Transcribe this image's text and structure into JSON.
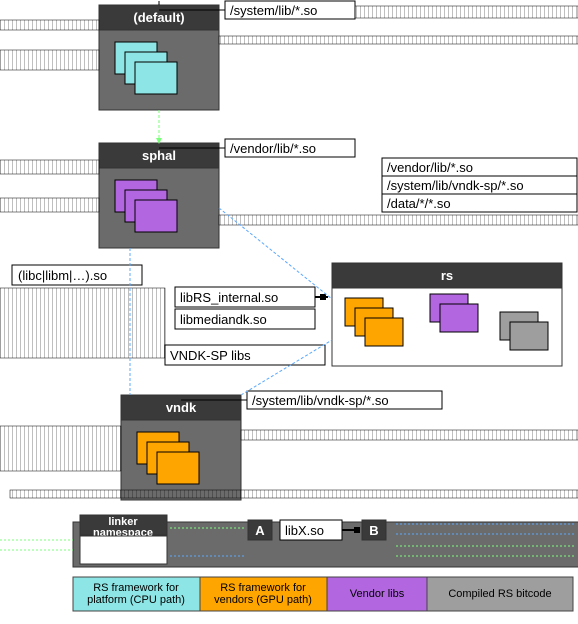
{
  "namespaces": {
    "default": {
      "title": "(default)",
      "search_path": "/system/lib/*.so"
    },
    "sphal": {
      "title": "sphal",
      "search_path": "/vendor/lib/*.so",
      "permitted": [
        "/vendor/lib/*.so",
        "/system/lib/vndk-sp/*.so",
        "/data/*/*.so"
      ]
    },
    "rs": {
      "title": "rs"
    },
    "vndk": {
      "title": "vndk",
      "search_path": "/system/lib/vndk-sp/*.so"
    }
  },
  "details": {
    "libc_group": "(libc|libm|…).so",
    "librs": "libRS_internal.so",
    "libmediandk": "libmediandk.so",
    "vndk_sp_libs": "VNDK-SP libs"
  },
  "legend": {
    "linker_ns": "linker\nnamespace",
    "a": "A",
    "libx": "libX.so",
    "b": "B",
    "colors": [
      {
        "label": "RS framework for\nplatform (CPU path)",
        "color": "#8ee5e5"
      },
      {
        "label": "RS framework for\nvendors (GPU path)",
        "color": "#ffa500"
      },
      {
        "label": "Vendor libs",
        "color": "#b266e0"
      },
      {
        "label": "Compiled RS bitcode",
        "color": "#9e9e9e"
      }
    ]
  }
}
